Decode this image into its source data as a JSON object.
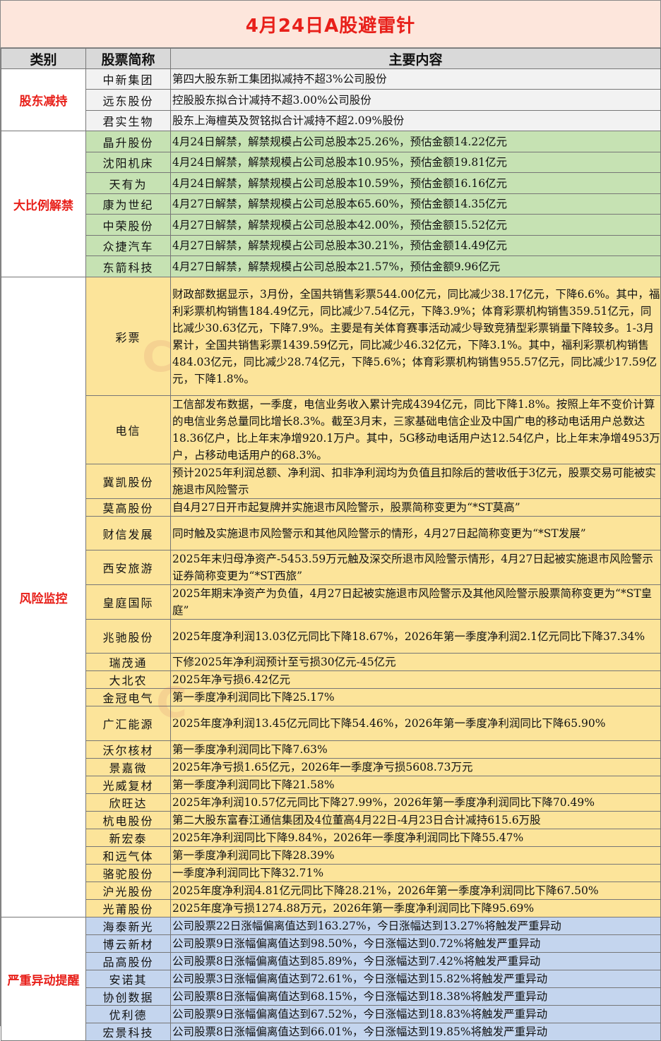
{
  "title": "4月24日A股避雷针",
  "headers": {
    "category": "类别",
    "name": "股票简称",
    "content": "主要内容"
  },
  "groups": [
    {
      "category": "股东减持",
      "style": "gray",
      "rows": [
        {
          "name": "中新集团",
          "content": "第四大股东新工集团拟减持不超3%公司股份",
          "h": 29
        },
        {
          "name": "远东股份",
          "content": "控股股东拟合计减持不超3.00%公司股份",
          "h": 30
        },
        {
          "name": "君实生物",
          "content": "股东上海檀英及贺铭拟合计减持不超2.09%股份",
          "h": 29
        }
      ]
    },
    {
      "category": "大比例解禁",
      "style": "green",
      "rows": [
        {
          "name": "晶升股份",
          "content": "4月24日解禁，解禁规模占公司总股本25.26%，预估金额14.22亿元",
          "h": 30
        },
        {
          "name": "沈阳机床",
          "content": "4月24日解禁，解禁规模占公司总股本10.95%，预估金额19.81亿元",
          "h": 29
        },
        {
          "name": "天有为",
          "content": "4月24日解禁，解禁规模占公司总股本10.59%，预估金额16.16亿元",
          "h": 30
        },
        {
          "name": "康为世纪",
          "content": "4月27日解禁，解禁规模占公司总股本65.60%，预估金额14.35亿元",
          "h": 29
        },
        {
          "name": "中荣股份",
          "content": "4月27日解禁，解禁规模占公司总股本42.00%，预估金额15.52亿元",
          "h": 30
        },
        {
          "name": "众捷汽车",
          "content": "4月27日解禁，解禁规模占公司总股本30.21%，预估金额14.49亿元",
          "h": 29
        },
        {
          "name": "东箭科技",
          "content": "4月27日解禁，解禁规模占公司总股本21.57%，预估金额9.96亿元",
          "h": 30
        }
      ]
    },
    {
      "category": "风险监控",
      "style": "yellow",
      "rows": [
        {
          "name": "彩票",
          "content": "财政部数据显示，3月份，全国共销售彩票544.00亿元，同比减少38.17亿元，下降6.6%。其中，福利彩票机构销售184.49亿元，同比减少7.54亿元，下降3.9%；体育彩票机构销售359.51亿元，同比减少30.63亿元，下降7.9%。主要是有关体育赛事活动减少导致竞猜型彩票销量下降较多。1-3月累计，全国共销售彩票1439.59亿元，同比减少46.32亿元，下降3.1%。其中，福利彩票机构销售484.03亿元，同比减少28.74亿元，下降5.6%；体育彩票机构销售955.57亿元，同比减少17.59亿元，下降1.8%。",
          "h": 168
        },
        {
          "name": "电信",
          "content": "工信部发布数据，一季度，电信业务收入累计完成4394亿元，同比下降1.8%。按照上年不变价计算的电信业务总量同比增长8.3%。截至3月末，三家基础电信企业及中国广电的移动电话用户总数达18.36亿户，比上年末净增920.1万户。其中，5G移动电话用户达12.54亿户，比上年末净增4953万户，占移动电话用户的68.3%。",
          "h": 96
        },
        {
          "name": "冀凯股份",
          "content": "预计2025年利润总额、净利润、扣非净利润均为负值且扣除后的营收低于3亿元，股票交易可能被实施退市风险警示",
          "h": 48
        },
        {
          "name": "莫高股份",
          "content": "自4月27日开市起复牌并实施退市风险警示，股票简称变更为“*ST莫高”",
          "h": 24
        },
        {
          "name": "财信发展",
          "content": "同时触及实施退市风险警示和其他风险警示的情形，4月27日起简称变更为“*ST发展”",
          "h": 48
        },
        {
          "name": "西安旅游",
          "content": "2025年末归母净资产-5453.59万元触及深交所退市风险警示情形，4月27日起被实施退市风险警示证券简称变更为“*ST西旅”",
          "h": 48
        },
        {
          "name": "皇庭国际",
          "content": "2025年期末净资产为负值，4月27日起被实施退市风险警示及其他风险警示股票简称变更为“*ST皇庭”",
          "h": 49
        },
        {
          "name": "兆驰股份",
          "content": "2025年度净利润13.03亿元同比下降18.67%，2026年第一季度净利润2.1亿元同比下降37.34%",
          "h": 48
        },
        {
          "name": "瑞茂通",
          "content": "下修2025年净利润预计至亏损30亿元-45亿元",
          "h": 24
        },
        {
          "name": "大北农",
          "content": "2025年净亏损6.42亿元",
          "h": 24
        },
        {
          "name": "金冠电气",
          "content": "第一季度净利润同比下降25.17%",
          "h": 24
        },
        {
          "name": "广汇能源",
          "content": "2025年度净利润13.45亿元同比下降54.46%，2026年第一季度净利润同比下降65.90%",
          "h": 49
        },
        {
          "name": "沃尔核材",
          "content": "第一季度净利润同比下降7.63%",
          "h": 24
        },
        {
          "name": "景嘉微",
          "content": "2025年净亏损1.65亿元，2026年一季度净亏损5608.73万元",
          "h": 24
        },
        {
          "name": "光威复材",
          "content": "第一季度净利润同比下降21.58%",
          "h": 24
        },
        {
          "name": "欣旺达",
          "content": "2025年净利润10.57亿元同比下降27.99%，2026年第一季度净利润同比下降70.49%",
          "h": 24
        },
        {
          "name": "杭电股份",
          "content": "第二大股东富春江通信集团及4位董高4月22日-4月23日合计减持615.6万股",
          "h": 24
        },
        {
          "name": "新宏泰",
          "content": "2025年净利润同比下降9.84%，2026年一季度净利润同比下降55.47%",
          "h": 24
        },
        {
          "name": "和远气体",
          "content": "第一季度净利润同比下降28.39%",
          "h": 24
        },
        {
          "name": "骆驼股份",
          "content": "一季度净利润同比下降32.71%",
          "h": 24
        },
        {
          "name": "沪光股份",
          "content": "2025年度净利润4.81亿元同比下降28.21%，2026年第一季度净利润同比下降67.50%",
          "h": 24
        },
        {
          "name": "光莆股份",
          "content": "2025年度净亏损1274.88万元，2026年第一季度净利润同比下降95.69%",
          "h": 24
        }
      ]
    },
    {
      "category": "严重异动提醒",
      "style": "blue",
      "rows": [
        {
          "name": "海泰新光",
          "content": "公司股票22日涨幅偏离值达到163.27%，今日涨幅达到13.27%将触发严重异动",
          "h": 24
        },
        {
          "name": "博云新材",
          "content": "公司股票9日涨幅偏离值达到98.50%，今日涨幅达到0.72%将触发严重异动",
          "h": 25
        },
        {
          "name": "品高股份",
          "content": "公司股票8日涨幅偏离值达到85.89%，今日涨幅达到7.42%将触发严重异动",
          "h": 24
        },
        {
          "name": "安诺其",
          "content": "公司股票3日涨幅偏离值达到72.61%，今日涨幅达到15.82%将触发严重异动",
          "h": 25
        },
        {
          "name": "协创数据",
          "content": "公司股票8日涨幅偏离值达到68.15%，今日涨幅达到18.38%将触发严重异动",
          "h": 24
        },
        {
          "name": "优利德",
          "content": "公司股票9日涨幅偏离值达到67.52%，今日涨幅达到18.83%将触发严重异动",
          "h": 25
        },
        {
          "name": "宏景科技",
          "content": "公司股票8日涨幅偏离值达到66.01%，今日涨幅达到19.85%将触发严重异动",
          "h": 24
        }
      ]
    }
  ]
}
